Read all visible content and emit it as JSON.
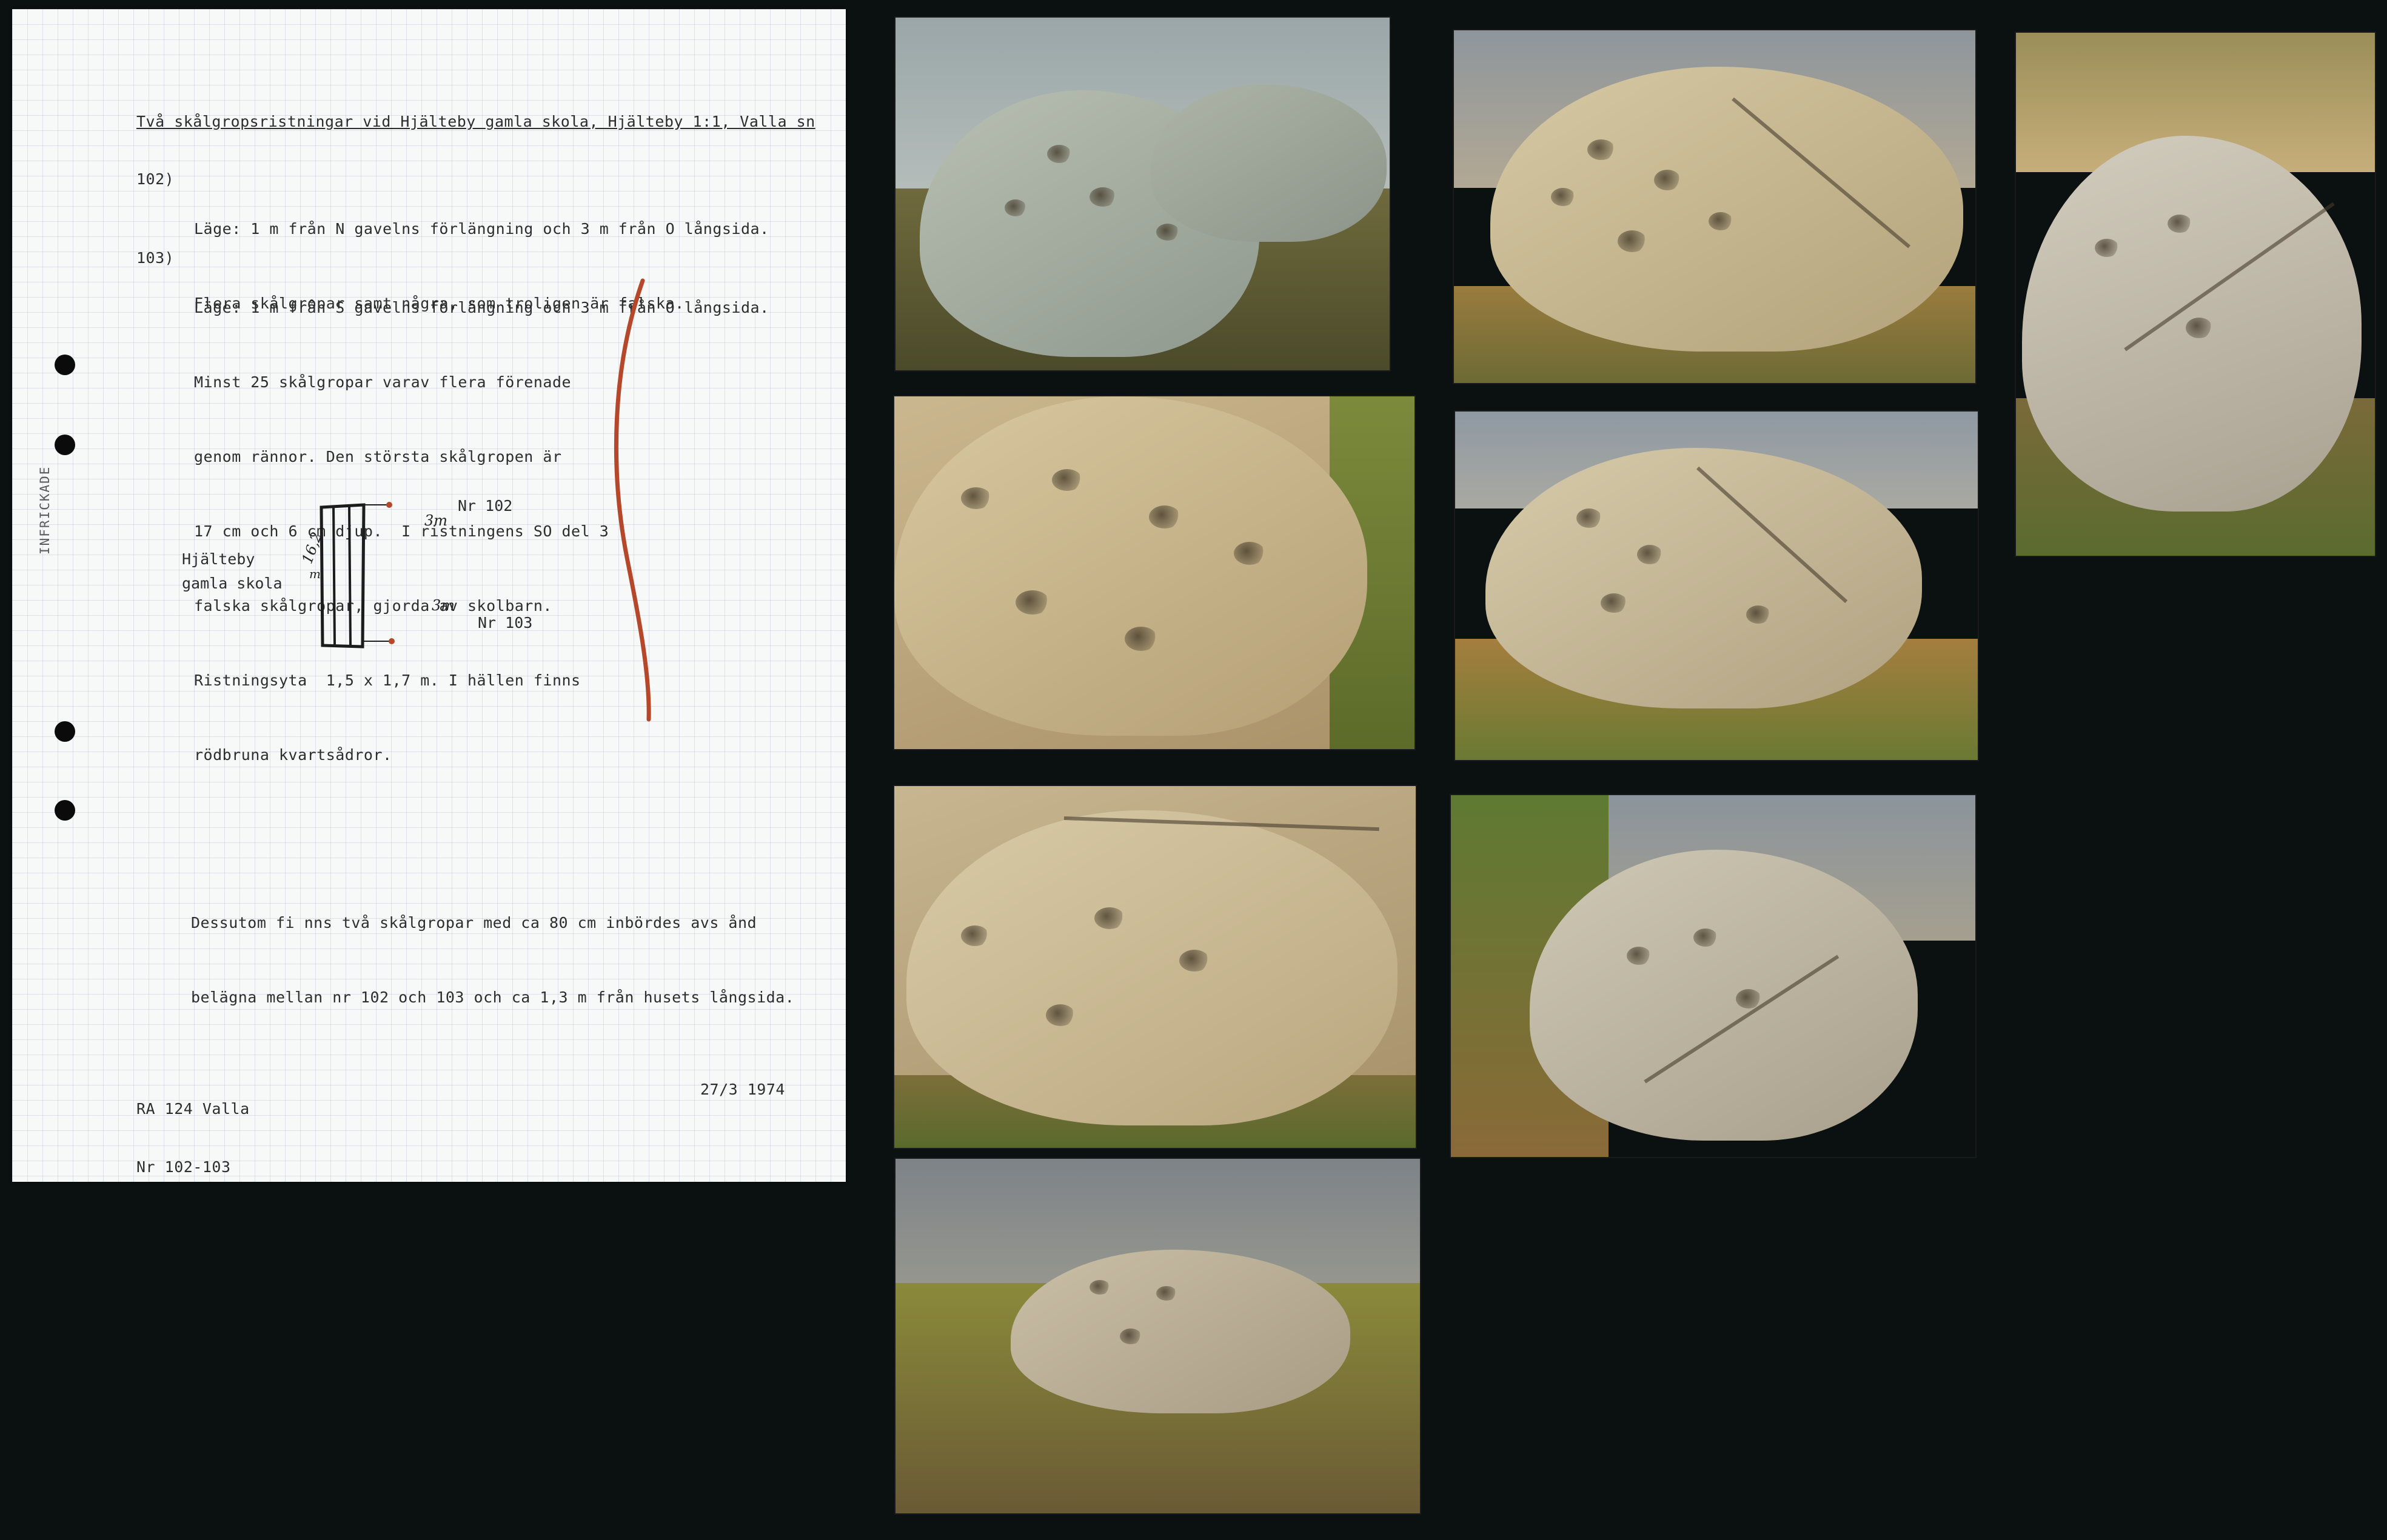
{
  "document": {
    "title": "Två skålgropsristningar vid Hjälteby gamla skola, Hjälteby 1:1, Valla sn",
    "entry_102": {
      "number": "102)",
      "lines": [
        "Läge: 1 m från N gavelns förlängning och 3 m från O långsida.",
        "Flera skålgropar samt några, som troligen är falska."
      ]
    },
    "entry_103": {
      "number": "103)",
      "lines": [
        "Läge: 1 m från S gavelns förlängning och 3 m från O långsida.",
        "Minst 25 skålgropar varav flera förenade",
        "genom rännor. Den största skålgropen är",
        "17 cm och 6 cm djup.  I ristningens SO del 3",
        "falska skålgropar, gjorda av skolbarn.",
        "Ristningsyta  1,5 x 1,7 m. I hällen finns",
        "rödbruna kvartsådror."
      ]
    },
    "stamp": "INFRICKADE",
    "sketch": {
      "building_label_1": "Hjälteby",
      "building_label_2": "gamla skola",
      "length": "16,2",
      "length_unit": "m",
      "dist_top": "3m",
      "dist_bottom": "3m",
      "label_102": "Nr 102",
      "label_103": "Nr 103"
    },
    "additional_lines": [
      "Dessutom fi nns två skålgropar med ca 80 cm inbördes avs ånd",
      "belägna mellan nr 102 och 103 och ca 1,3 m från husets långsida."
    ],
    "footer_left": [
      "RA 124 Valla",
      "Nr 102-103"
    ],
    "footer_date": "27/3 1974"
  },
  "photos": [
    {
      "id": "photo-1",
      "subject": "rock-carving-cupmarks"
    },
    {
      "id": "photo-2",
      "subject": "rock-carving-cupmarks"
    },
    {
      "id": "photo-3",
      "subject": "rock-carving-cupmarks"
    },
    {
      "id": "photo-4",
      "subject": "rock-carving-cupmarks"
    },
    {
      "id": "photo-5",
      "subject": "rock-carving-cupmarks"
    },
    {
      "id": "photo-6",
      "subject": "rock-carving-cupmarks"
    },
    {
      "id": "photo-7",
      "subject": "rock-carving-cupmarks"
    },
    {
      "id": "photo-8",
      "subject": "rock-carving-cupmarks"
    },
    {
      "id": "photo-9",
      "subject": "rock-carving-cupmarks"
    }
  ],
  "colors": {
    "background": "#0b1010",
    "paper": "#f7f8f8",
    "red_line": "#b5482a",
    "rock": "#c9b48a",
    "grass": "#8a7a3a"
  }
}
